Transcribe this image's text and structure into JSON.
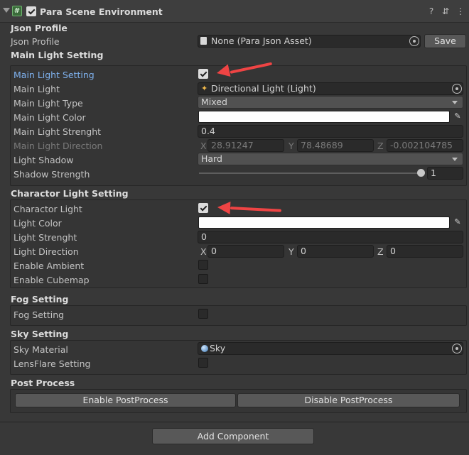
{
  "header": {
    "title": "Para Scene Environment",
    "help_icon": "help-icon",
    "preset_icon": "preset-icon",
    "menu_icon": "more-vert-icon"
  },
  "json_profile": {
    "section": "Json Profile",
    "label": "Json Profile",
    "value": "None (Para Json Asset)",
    "save_label": "Save"
  },
  "main_light": {
    "section": "Main Light Setting",
    "enable_label": "Main Light Setting",
    "light_label": "Main Light",
    "light_value": "Directional Light (Light)",
    "type_label": "Main Light Type",
    "type_value": "Mixed",
    "color_label": "Main Light Color",
    "color_value": "#FFFFFF",
    "strength_label": "Main Light Strenght",
    "strength_value": "0.4",
    "direction_label": "Main Light Direction",
    "dir_x_label": "X",
    "dir_x": "28.91247",
    "dir_y_label": "Y",
    "dir_y": "78.48689",
    "dir_z_label": "Z",
    "dir_z": "-0.002104785",
    "shadow_label": "Light Shadow",
    "shadow_value": "Hard",
    "shadow_strength_label": "Shadow Strength",
    "shadow_strength_value": "1"
  },
  "charactor_light": {
    "section": "Charactor Light Setting",
    "enable_label": "Charactor Light",
    "color_label": "Light Color",
    "color_value": "#FFFFFF",
    "strength_label": "Light Strenght",
    "strength_value": "0",
    "direction_label": "Light Direction",
    "dir_x_label": "X",
    "dir_x": "0",
    "dir_y_label": "Y",
    "dir_y": "0",
    "dir_z_label": "Z",
    "dir_z": "0",
    "ambient_label": "Enable Ambient",
    "cubemap_label": "Enable Cubemap"
  },
  "fog": {
    "section": "Fog Setting",
    "label": "Fog Setting"
  },
  "sky": {
    "section": "Sky Setting",
    "material_label": "Sky Material",
    "material_value": "Sky",
    "lensflare_label": "LensFlare Setting"
  },
  "post": {
    "section": "Post Process",
    "enable_label": "Enable PostProcess",
    "disable_label": "Disable PostProcess"
  },
  "footer": {
    "add_component_label": "Add Component"
  },
  "colors": {
    "accent": "#7fb2ef",
    "annotation": "#ef4444"
  }
}
